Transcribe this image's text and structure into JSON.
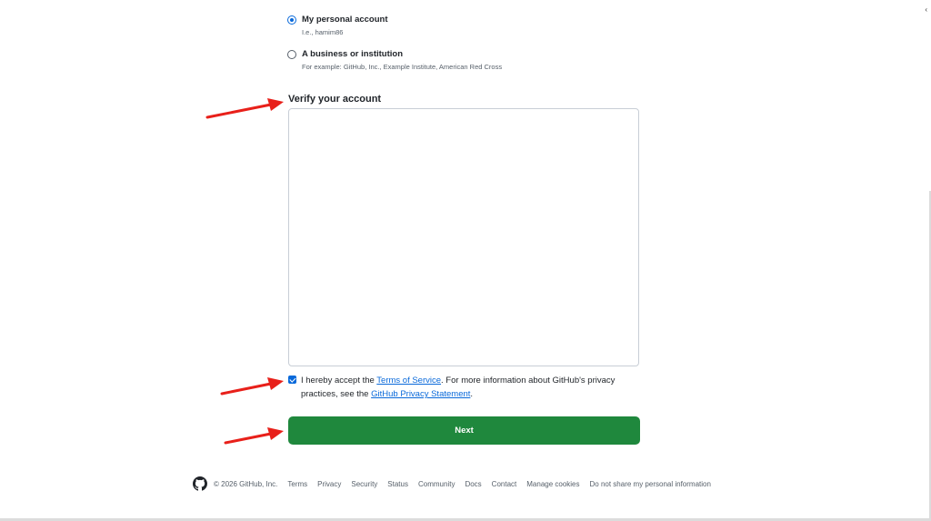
{
  "account_type": {
    "options": [
      {
        "label": "My personal account",
        "note": "I.e., hamim86",
        "checked": true
      },
      {
        "label": "A business or institution",
        "note": "For example: GitHub, Inc., Example Institute, American Red Cross",
        "checked": false
      }
    ]
  },
  "verify": {
    "title": "Verify your account"
  },
  "terms": {
    "text_before": "I hereby accept the ",
    "tos_link": "Terms of Service",
    "text_middle": ". For more information about GitHub's privacy practices, see the ",
    "privacy_link": "GitHub Privacy Statement",
    "text_after": ".",
    "checked": true
  },
  "next_button": {
    "label": "Next"
  },
  "footer": {
    "copyright": "© 2026 GitHub, Inc.",
    "links": [
      "Terms",
      "Privacy",
      "Security",
      "Status",
      "Community",
      "Docs",
      "Contact",
      "Manage cookies",
      "Do not share my personal information"
    ]
  },
  "colors": {
    "primary_button": "#1f883d",
    "link": "#0969da",
    "annotation_arrow": "#e8201a"
  },
  "icons": {
    "footer_logo": "github-octocat-icon",
    "annotation": "red-arrow-icon"
  },
  "edge_mark": "‹"
}
